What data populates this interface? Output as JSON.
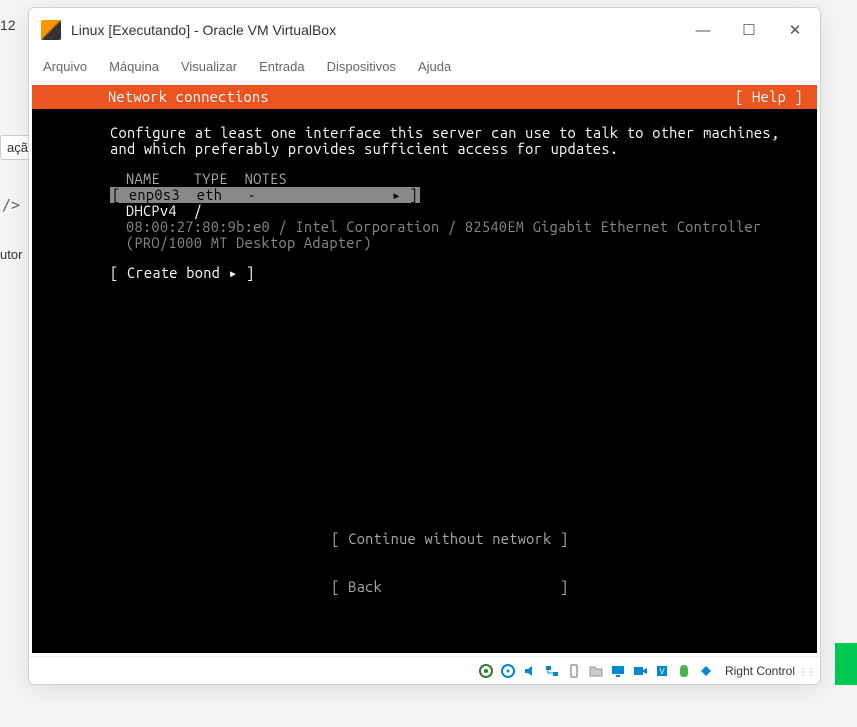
{
  "background": {
    "frag_12": "12",
    "frag_acao": "ação",
    "frag_code": "/>",
    "frag_utor": "utor"
  },
  "window": {
    "title": "Linux [Executando] - Oracle VM VirtualBox",
    "menu": {
      "arquivo": "Arquivo",
      "maquina": "Máquina",
      "visualizar": "Visualizar",
      "entrada": "Entrada",
      "dispositivos": "Dispositivos",
      "ajuda": "Ajuda"
    },
    "hostkey": "Right Control"
  },
  "screen": {
    "title": "Network connections",
    "help": "[ Help ]",
    "instructions": "Configure at least one interface this server can use to talk to other machines, and which preferably provides sufficient access for updates.",
    "headers": {
      "name": "NAME",
      "type": "TYPE",
      "notes": "NOTES"
    },
    "interface": {
      "name": "enp0s3",
      "type": "eth",
      "notes": "-",
      "indicator": "▸",
      "dhcp": "DHCPv4",
      "dhcp_sep": "/",
      "hw": "08:00:27:80:9b:e0 / Intel Corporation / 82540EM Gigabit Ethernet Controller (PRO/1000 MT Desktop Adapter)"
    },
    "create_bond": "[ Create bond ▸ ]",
    "buttons": {
      "continue": "[ Continue without network ]",
      "back": "[ Back                     ]"
    }
  }
}
